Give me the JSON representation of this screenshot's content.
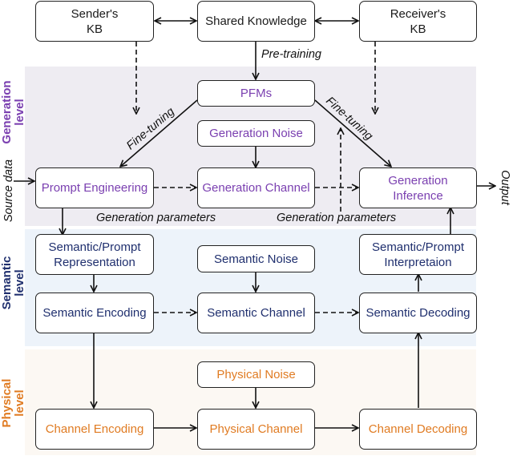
{
  "diagram": {
    "levels": {
      "generation": {
        "label": "Generation\nlevel",
        "color": "#7a3fb0",
        "band_color": "#eeecf2"
      },
      "semantic": {
        "label": "Semantic\nlevel",
        "color": "#1f2f6e",
        "band_color": "#edf3fa"
      },
      "physical": {
        "label": "Physical\nlevel",
        "color": "#e07b22",
        "band_color": "#fcf8f3"
      }
    },
    "nodes": {
      "senders_kb": "Sender's\nKB",
      "shared_knowledge": "Shared Knowledge",
      "receivers_kb": "Receiver's\nKB",
      "pfms": "PFMs",
      "generation_noise": "Generation Noise",
      "prompt_engineering": "Prompt Engineering",
      "generation_channel": "Generation Channel",
      "generation_inference": "Generation\nInference",
      "semantic_prompt_representation": "Semantic/Prompt\nRepresentation",
      "semantic_noise": "Semantic Noise",
      "semantic_prompt_interpretation": "Semantic/Prompt\nInterpretaion",
      "semantic_encoding": "Semantic Encoding",
      "semantic_channel": "Semantic Channel",
      "semantic_decoding": "Semantic Decoding",
      "physical_noise": "Physical Noise",
      "channel_encoding": "Channel Encoding",
      "physical_channel": "Physical Channel",
      "channel_decoding": "Channel Decoding"
    },
    "edge_labels": {
      "pre_training": "Pre-training",
      "fine_tuning_left": "Fine-tuning",
      "fine_tuning_right": "Fine-tuning",
      "generation_parameters_left": "Generation parameters",
      "generation_parameters_right": "Generation parameters",
      "source_data": "Source data",
      "output": "Output"
    }
  }
}
